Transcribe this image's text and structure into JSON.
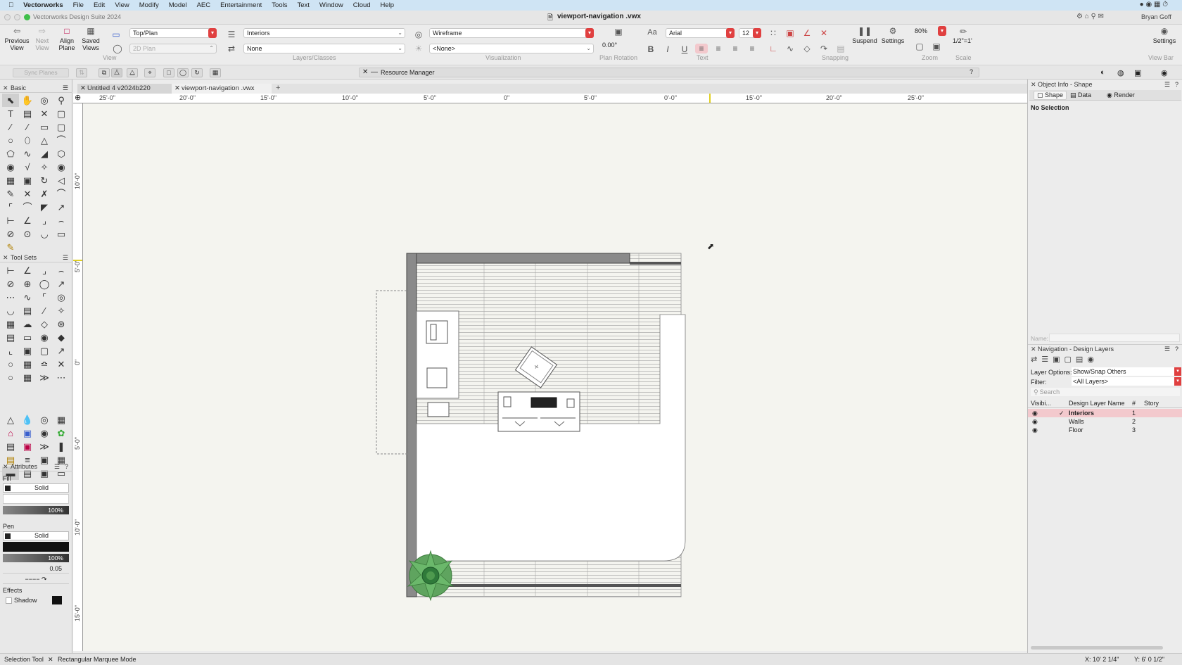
{
  "menubar": {
    "app": "Vectorworks",
    "items": [
      "File",
      "Edit",
      "View",
      "Modify",
      "Model",
      "AEC",
      "Entertainment",
      "Tools",
      "Text",
      "Window",
      "Cloud",
      "Help"
    ]
  },
  "titlebar": {
    "app_title": "Vectorworks Design Suite 2024",
    "doc_title": "viewport-navigation .vwx",
    "user": "Bryan Goff"
  },
  "toolbar": {
    "previous_view": "Previous View",
    "next_view": "Next View",
    "align_plane": "Align Plane",
    "saved_views": "Saved Views",
    "view_select": "Top/Plan",
    "render_plane": "2D Plan",
    "layer_select": "Interiors",
    "class_select": "None",
    "render_mode": "Wireframe",
    "lighting": "<None>",
    "plan_rotation": "0.00°",
    "font": "Arial",
    "font_size": "12",
    "suspend": "Suspend",
    "settings": "Settings",
    "zoom": "80%",
    "scale": "1/2\"=1'",
    "settings_right": "Settings",
    "groups": {
      "view": "View",
      "layers_classes": "Layers/Classes",
      "visualization": "Visualization",
      "plan_rotation": "Plan Rotation",
      "text": "Text",
      "snapping": "Snapping",
      "zoom": "Zoom",
      "scale": "Scale",
      "view_bar": "View Bar"
    }
  },
  "modebar": {
    "sync_planes": "Sync Planes",
    "resource_manager": "Resource Manager"
  },
  "panels": {
    "basic": "Basic",
    "tool_sets": "Tool Sets",
    "attributes": "Attributes",
    "fill_label": "Fill",
    "fill_style": "Solid",
    "fill_opacity": "100%",
    "pen_label": "Pen",
    "pen_style": "Solid",
    "pen_opacity": "100%",
    "line_weight": "0.05",
    "effects": "Effects",
    "shadow": "Shadow"
  },
  "doc_tabs": [
    "Untitled 4 v2024b220",
    "viewport-navigation .vwx"
  ],
  "ruler_h": [
    "25'-0\"",
    "20'-0\"",
    "15'-0\"",
    "10'-0\"",
    "5'-0\"",
    "0\"",
    "5'-0\"",
    "0'-0\"",
    "15'-0\"",
    "20'-0\"",
    "25'-0\""
  ],
  "ruler_v": [
    "10'-0\"",
    "5'-0\"",
    "0\"",
    "5'-0\"",
    "10'-0\"",
    "15'-0\""
  ],
  "object_info": {
    "title": "Object Info - Shape",
    "tabs": [
      "Shape",
      "Data",
      "Render"
    ],
    "selection": "No Selection",
    "name_label": "Name:"
  },
  "navigation": {
    "title": "Navigation - Design Layers",
    "layer_options_label": "Layer Options:",
    "layer_options_value": "Show/Snap Others",
    "filter_label": "Filter:",
    "filter_value": "<All Layers>",
    "search_placeholder": "Search",
    "columns": [
      "Visibi...",
      "Design Layer Name",
      "#",
      "Story"
    ],
    "layers": [
      {
        "name": "Interiors",
        "num": "1",
        "active": true
      },
      {
        "name": "Walls",
        "num": "2",
        "active": false
      },
      {
        "name": "Floor",
        "num": "3",
        "active": false
      }
    ]
  },
  "status": {
    "tool": "Selection Tool",
    "mode": "Rectangular Marquee Mode",
    "x": "X: 10' 2 1/4\"",
    "y": "Y: 6' 0 1/2\""
  },
  "colors": {
    "accent_red": "#e04040",
    "active_layer_row": "#f3c9cd",
    "plant_green": "#4e9a4e"
  }
}
